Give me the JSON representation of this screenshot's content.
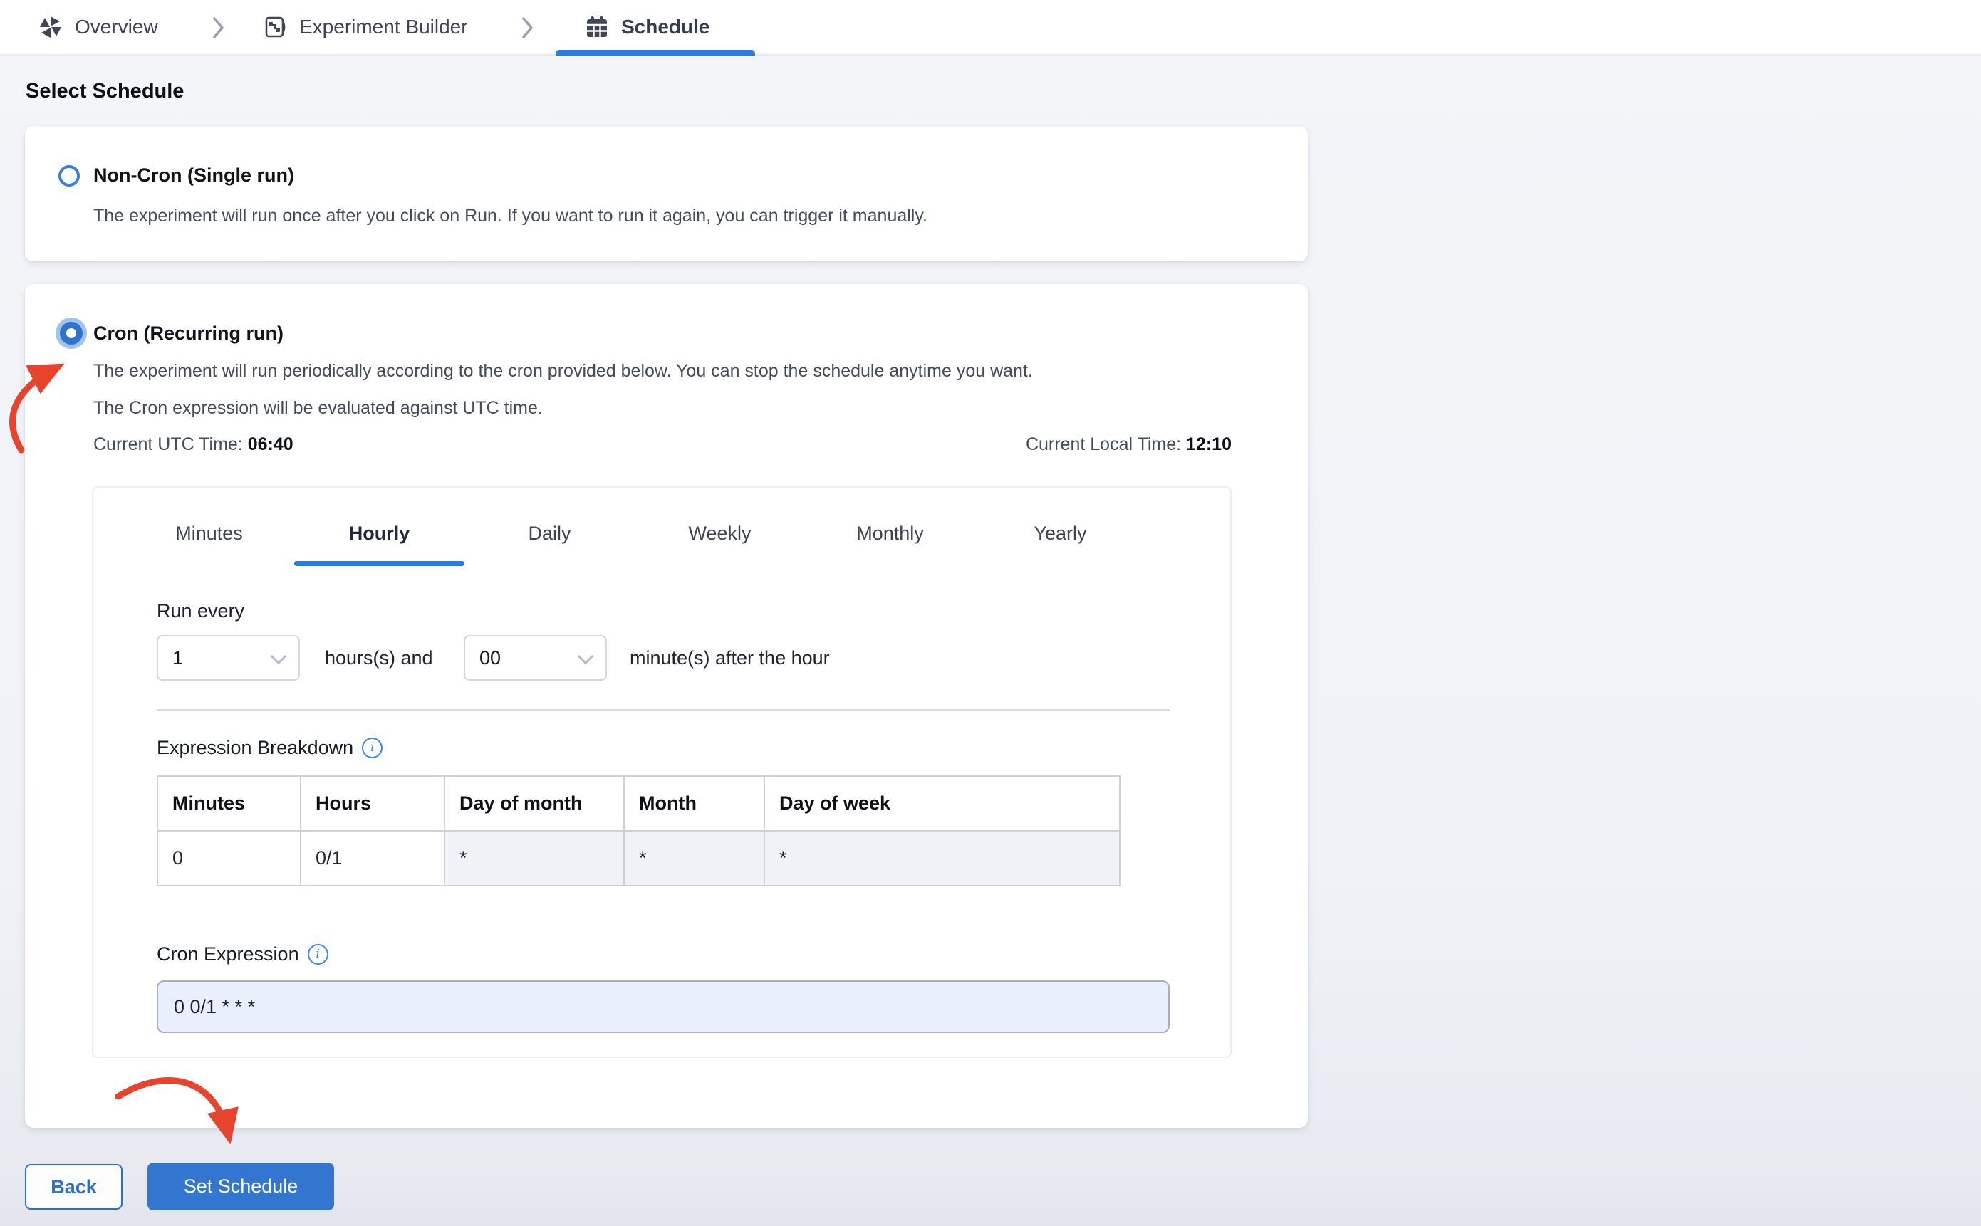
{
  "breadcrumb": {
    "items": [
      {
        "label": "Overview",
        "icon": "overview-icon"
      },
      {
        "label": "Experiment Builder",
        "icon": "experiment-builder-icon"
      },
      {
        "label": "Schedule",
        "icon": "calendar-icon",
        "active": true
      }
    ]
  },
  "page": {
    "title": "Select Schedule"
  },
  "options": {
    "non_cron": {
      "label": "Non-Cron (Single run)",
      "description": "The experiment will run once after you click on Run. If you want to run it again, you can trigger it manually.",
      "selected": false
    },
    "cron": {
      "label": "Cron (Recurring run)",
      "description_line1": "The experiment will run periodically according to the cron provided below. You can stop the schedule anytime you want.",
      "description_line2": "The Cron expression will be evaluated against UTC time.",
      "utc_label": "Current UTC Time:",
      "utc_value": "06:40",
      "local_label": "Current Local Time:",
      "local_value": "12:10",
      "selected": true
    }
  },
  "scheduler": {
    "tabs": [
      "Minutes",
      "Hourly",
      "Daily",
      "Weekly",
      "Monthly",
      "Yearly"
    ],
    "active_tab": "Hourly",
    "run_every_label": "Run every",
    "hours_value": "1",
    "hours_suffix": "hours(s) and",
    "minutes_value": "00",
    "minutes_suffix": "minute(s) after the hour",
    "expression_breakdown_label": "Expression Breakdown",
    "table": {
      "headers": [
        "Minutes",
        "Hours",
        "Day of month",
        "Month",
        "Day of week"
      ],
      "row": [
        "0",
        "0/1",
        "*",
        "*",
        "*"
      ]
    },
    "cron_expression_label": "Cron Expression",
    "cron_expression_value": "0 0/1 * * *"
  },
  "footer": {
    "back_label": "Back",
    "set_schedule_label": "Set Schedule"
  },
  "colors": {
    "accent_blue": "#2b7cdf",
    "button_blue": "#3376d0",
    "radio_blue": "#2e74cf",
    "radio_halo": "#a2c3ea",
    "arrow_red": "#e8432c",
    "shaded_cell": "#f1f1f8",
    "cron_input_bg": "#e9f0fb"
  }
}
